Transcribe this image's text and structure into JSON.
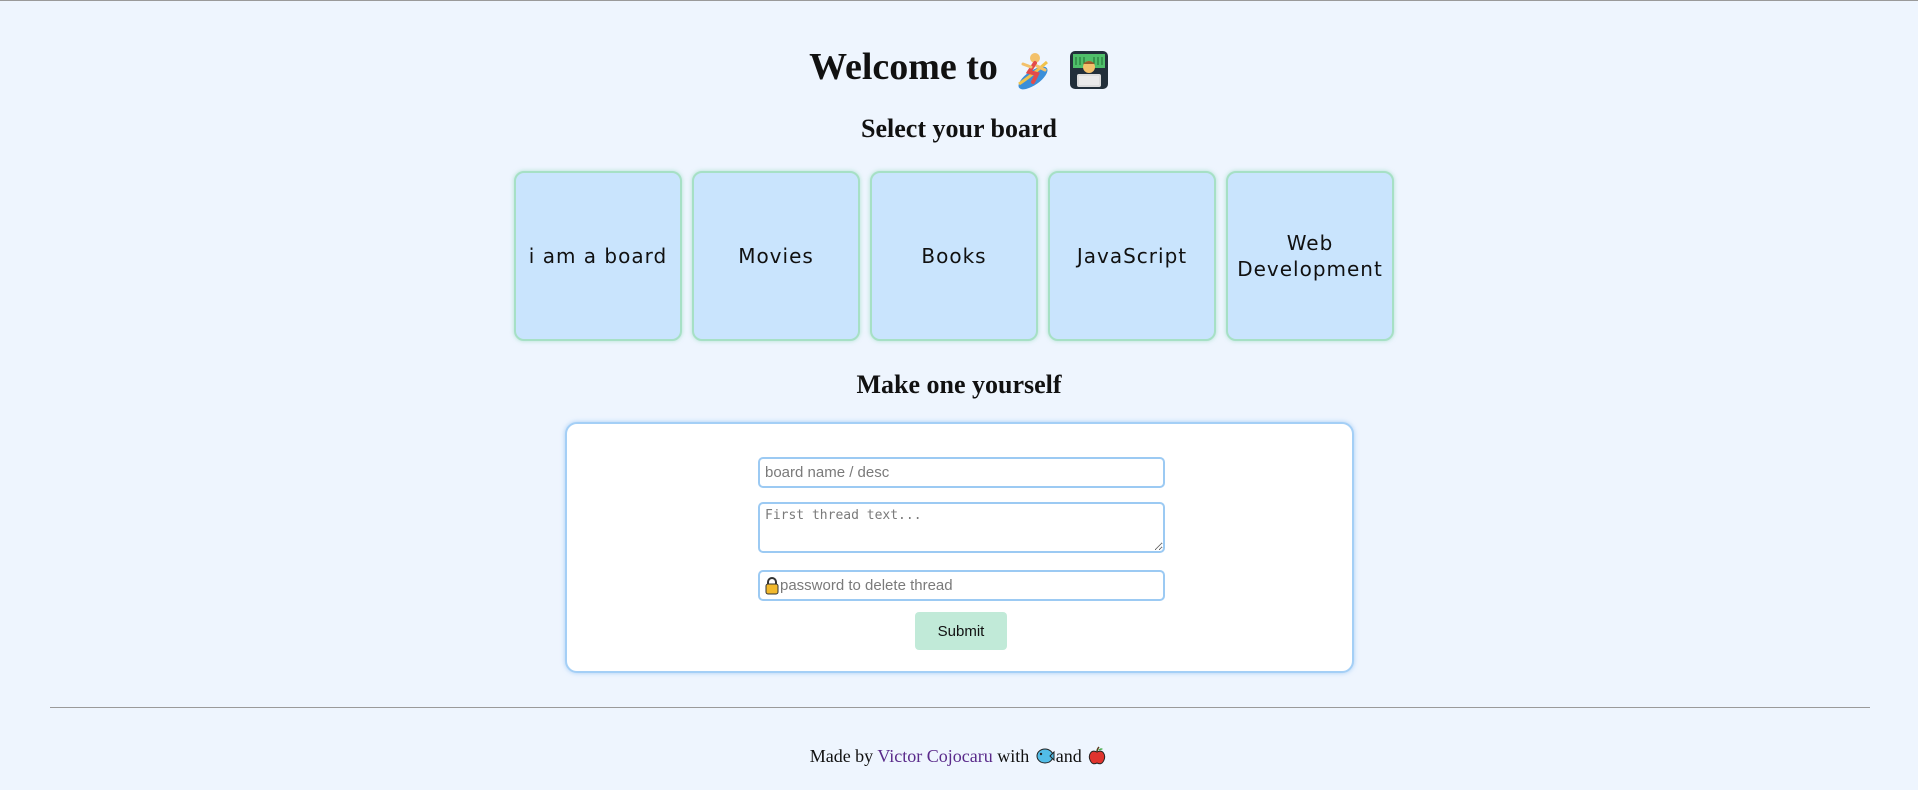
{
  "header": {
    "title": "Welcome to",
    "icons": [
      "surfer-emoji-icon",
      "technologist-emoji-icon"
    ]
  },
  "boards_section": {
    "title": "Select your board",
    "boards": [
      {
        "label": "i am a board"
      },
      {
        "label": "Movies"
      },
      {
        "label": "Books"
      },
      {
        "label": "JavaScript"
      },
      {
        "label": "Web Development"
      }
    ]
  },
  "create_section": {
    "title": "Make one yourself",
    "board_name_placeholder": "board name / desc",
    "thread_text_placeholder": "First thread text...",
    "password_placeholder": "password to delete thread",
    "password_icon": "lock-icon",
    "submit_label": "Submit"
  },
  "footer": {
    "made_by": "Made by",
    "author": "Victor Cojocaru",
    "with": "with",
    "and": "and",
    "icons": [
      "fish-icon",
      "apple-icon"
    ]
  },
  "colors": {
    "background": "#eef5fe",
    "board_card": "#c9e4fd",
    "board_border": "#a6e0c5",
    "form_border": "#a4cff6",
    "submit": "#c1ead8",
    "link": "#5a2a8a"
  }
}
